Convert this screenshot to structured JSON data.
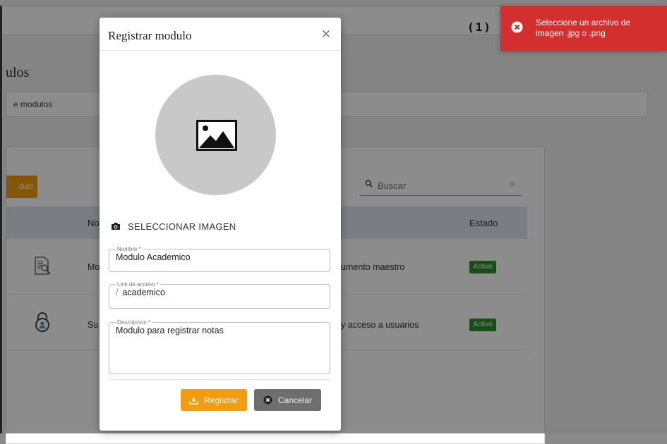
{
  "topbar": {
    "counter": "(1)"
  },
  "page": {
    "title": "ulos",
    "breadcrumb": "e modulos"
  },
  "table": {
    "add_button": "dulo",
    "search": {
      "placeholder": "Buscar"
    },
    "headers": {
      "nombre": "No",
      "estado": "Estado"
    },
    "rows": [
      {
        "icon": "document-search-icon",
        "name": "Mo",
        "description": "umento maestro",
        "status": "Activo"
      },
      {
        "icon": "lock-user-icon",
        "name": "Su",
        "description": "y acceso a usuarios",
        "status": "Activo"
      }
    ]
  },
  "modal": {
    "title": "Registrar modulo",
    "select_image_label": "SELECCIONAR IMAGEN",
    "fields": {
      "nombre": {
        "label": "Nombre *",
        "value": "Modulo Academico"
      },
      "link": {
        "label": "Link de acceso *",
        "prefix": "/",
        "value": "academico"
      },
      "descripcion": {
        "label": "Descripcion *",
        "value": "Modulo para registrar notas"
      }
    },
    "buttons": {
      "register": "Registrar",
      "cancel": "Cancelar"
    }
  },
  "toast": {
    "message": "Seleccione un archivo de imagen .jpg o .png",
    "color": "#d32f2f"
  },
  "colors": {
    "accent": "#f39c12",
    "success": "#2d8a2d",
    "danger": "#d32f2f"
  }
}
